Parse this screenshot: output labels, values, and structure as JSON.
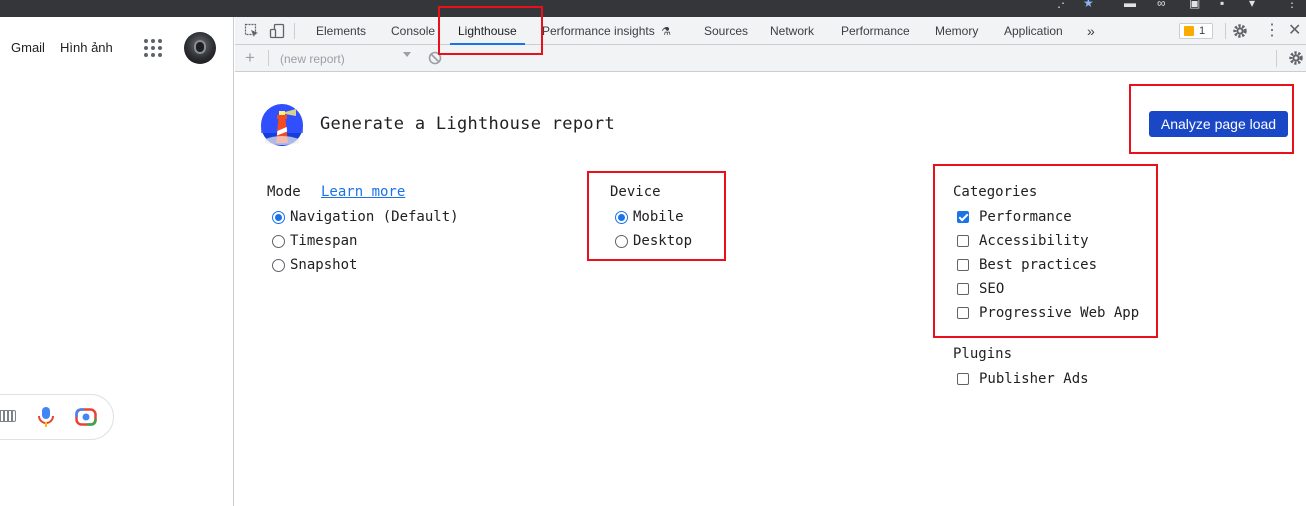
{
  "browser": {
    "top_icons": [
      "ellipsis-icon",
      "star-icon",
      "extension-icon",
      "puzzle-icon",
      "profile-icon",
      "menu-icon"
    ],
    "accent": "#1a73e8"
  },
  "google_page": {
    "links": [
      "Gmail",
      "Hình ảnh"
    ],
    "apps_icon": "apps-grid-icon",
    "avatar": "account-avatar",
    "search_icons": [
      "keyboard-icon",
      "microphone-icon",
      "lens-camera-icon"
    ]
  },
  "devtools": {
    "tabs": [
      {
        "label": "Elements",
        "active": false
      },
      {
        "label": "Console",
        "active": false
      },
      {
        "label": "Lighthouse",
        "active": true
      },
      {
        "label": "Performance insights",
        "active": false
      },
      {
        "label": "Sources",
        "active": false
      },
      {
        "label": "Network",
        "active": false
      },
      {
        "label": "Performance",
        "active": false
      },
      {
        "label": "Memory",
        "active": false
      },
      {
        "label": "Application",
        "active": false
      }
    ],
    "more_tabs": "»",
    "issues_count": "1",
    "report_select": "(new report)",
    "icons": [
      "inspect-element-icon",
      "device-toolbar-icon",
      "experiment-flask-icon",
      "settings-gear-icon",
      "kebab-menu-icon",
      "close-icon"
    ]
  },
  "lighthouse": {
    "title": "Generate a Lighthouse report",
    "analyze_button": "Analyze page load",
    "mode": {
      "heading": "Mode",
      "learn_more": "Learn more",
      "options": [
        {
          "label": "Navigation (Default)",
          "selected": true
        },
        {
          "label": "Timespan",
          "selected": false
        },
        {
          "label": "Snapshot",
          "selected": false
        }
      ]
    },
    "device": {
      "heading": "Device",
      "options": [
        {
          "label": "Mobile",
          "selected": true
        },
        {
          "label": "Desktop",
          "selected": false
        }
      ]
    },
    "categories": {
      "heading": "Categories",
      "options": [
        {
          "label": "Performance",
          "checked": true
        },
        {
          "label": "Accessibility",
          "checked": false
        },
        {
          "label": "Best practices",
          "checked": false
        },
        {
          "label": "SEO",
          "checked": false
        },
        {
          "label": "Progressive Web App",
          "checked": false
        }
      ]
    },
    "plugins": {
      "heading": "Plugins",
      "options": [
        {
          "label": "Publisher Ads",
          "checked": false
        }
      ]
    }
  },
  "annotations": {
    "highlight_color": "#e8101a",
    "highlighted": [
      "lighthouse-tab",
      "analyze-button",
      "device-section",
      "categories-section"
    ]
  }
}
